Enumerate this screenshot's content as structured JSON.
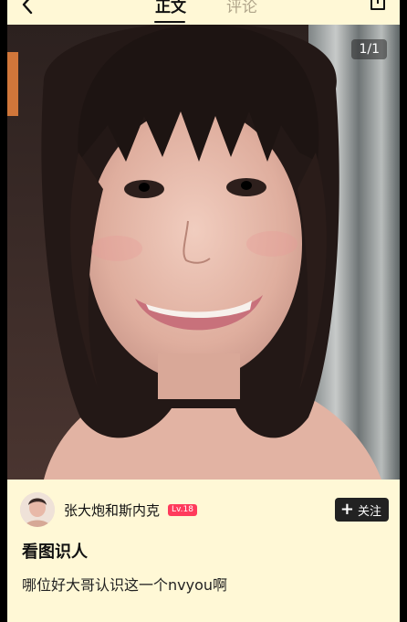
{
  "nav": {
    "tabs": [
      {
        "label": "正文",
        "active": true
      },
      {
        "label": "评论",
        "active": false
      }
    ]
  },
  "photo": {
    "counter": "1/1",
    "subject": "portrait of a woman with black bangs, smiling, in front of a curtain"
  },
  "author": {
    "name": "张大炮和斯内克",
    "level": "Lv.18",
    "follow_label": "关注"
  },
  "post": {
    "title": "看图识人",
    "body": "哪位好大哥认识这一个nvyou啊"
  },
  "colors": {
    "background": "#fff8d6",
    "level_badge": "#ff3b5c",
    "follow_button": "#222222"
  }
}
